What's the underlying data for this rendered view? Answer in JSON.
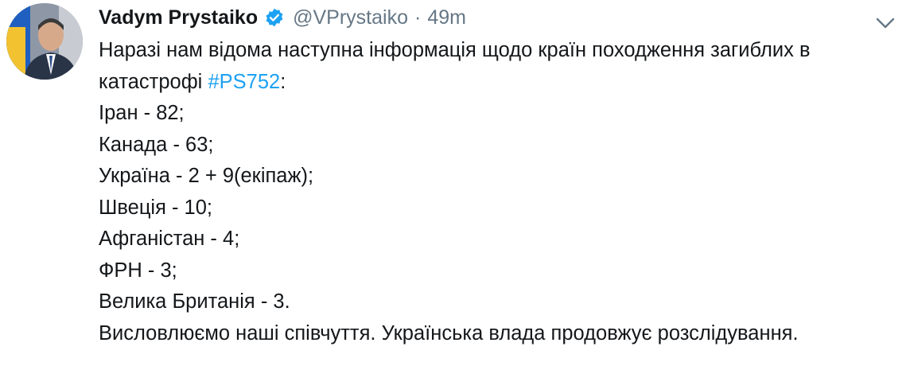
{
  "tweet": {
    "author": {
      "display_name": "Vadym Prystaiko",
      "handle": "@VPrystaiko",
      "verified": true,
      "avatar_icon": "profile-photo"
    },
    "separator": "·",
    "timestamp": "49m",
    "menu_icon": "chevron-down-icon",
    "text": {
      "line1": "Наразі нам відома наступна інформація щодо країн походження загиблих в",
      "line2_prefix": "катастрофі ",
      "hashtag": "#PS752",
      "line2_suffix": ":",
      "countries": [
        "Іран - 82;",
        "Канада - 63;",
        "Україна - 2 + 9(екіпаж);",
        "Швеція - 10;",
        "Афганістан - 4;",
        "ФРН - 3;",
        "Велика Британія - 3."
      ],
      "closing": "Висловлюємо наші співчуття. Українська влада продовжує розслідування."
    }
  },
  "colors": {
    "text": "#14171a",
    "secondary": "#657786",
    "link": "#1da1f2",
    "verified_badge": "#1da1f2"
  }
}
